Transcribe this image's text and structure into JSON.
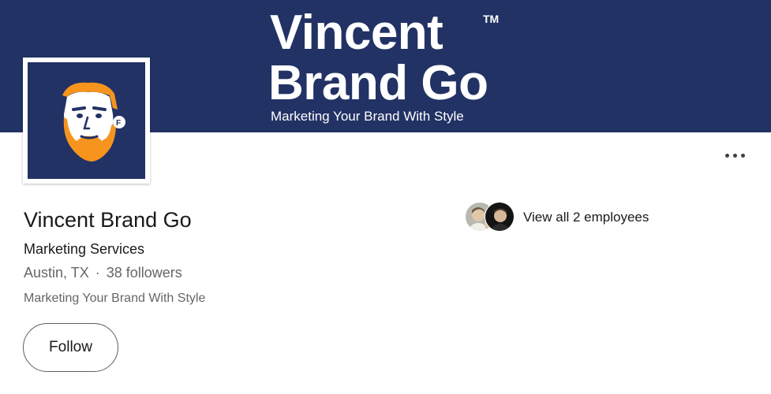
{
  "banner": {
    "brand_line1": "Vincent",
    "brand_line2": "Brand Go",
    "trademark": "TM",
    "tagline": "Marketing Your Brand With Style"
  },
  "company": {
    "name": "Vincent Brand Go",
    "industry": "Marketing Services",
    "location": "Austin, TX",
    "separator": "·",
    "followers": "38 followers",
    "tagline": "Marketing Your Brand With Style"
  },
  "actions": {
    "follow_label": "Follow",
    "more_icon": "ellipsis-icon"
  },
  "employees": {
    "label": "View all 2 employees"
  },
  "colors": {
    "banner_bg": "#223265",
    "beard_orange": "#F7941D",
    "text_primary": "#191919",
    "text_secondary": "#666666"
  }
}
